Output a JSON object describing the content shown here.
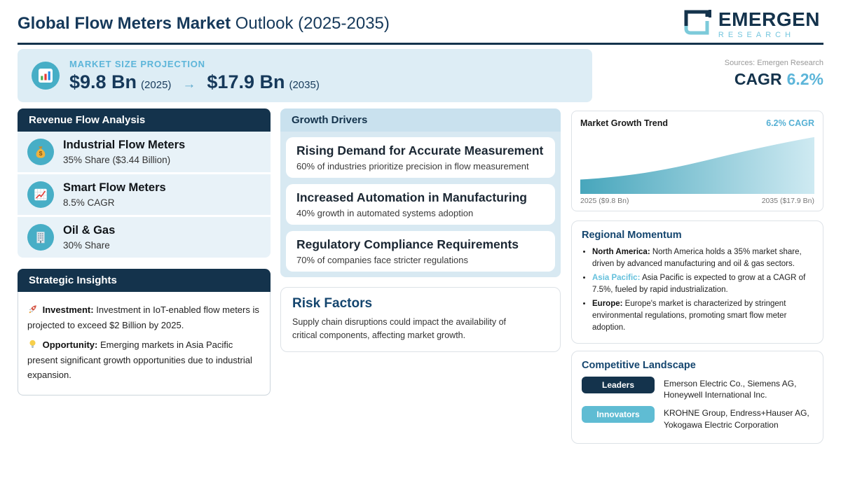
{
  "page": {
    "title_bold": "Global Flow Meters Market",
    "title_rest": " Outlook (2025-2035)"
  },
  "logo": {
    "name": "EMERGEN",
    "sub": "RESEARCH",
    "mark_icon": "emergen-square-logo-icon"
  },
  "banner": {
    "icon": "bar-chart-icon",
    "label": "MARKET SIZE PROJECTION",
    "start_value": "$9.8 Bn",
    "start_year": "(2025)",
    "arrow": "→",
    "end_value": "$17.9 Bn",
    "end_year": "(2035)",
    "sources": "Sources: Emergen Research",
    "cagr_label": "CAGR",
    "cagr_value": "6.2%"
  },
  "revenue": {
    "header": "Revenue Flow Analysis",
    "items": [
      {
        "icon": "money-bag-icon",
        "title": "Industrial Flow Meters",
        "subtitle": "35% Share ($3.44 Billion)"
      },
      {
        "icon": "line-chart-icon",
        "title": "Smart Flow Meters",
        "subtitle": "8.5% CAGR"
      },
      {
        "icon": "building-icon",
        "title": "Oil & Gas",
        "subtitle": "30% Share"
      }
    ]
  },
  "strategic": {
    "header": "Strategic Insights",
    "items": [
      {
        "icon": "rocket-icon",
        "label": "Investment:",
        "text": " Investment in IoT-enabled flow meters is projected to exceed $2 Billion by 2025."
      },
      {
        "icon": "bulb-icon",
        "label": "Opportunity:",
        "text": " Emerging markets in Asia Pacific present significant growth opportunities due to industrial expansion."
      }
    ]
  },
  "growth": {
    "header": "Growth Drivers",
    "items": [
      {
        "title": "Rising Demand for Accurate Measurement",
        "subtitle": "60% of industries prioritize precision in flow measurement"
      },
      {
        "title": "Increased Automation in Manufacturing",
        "subtitle": "40% growth in automated systems adoption"
      },
      {
        "title": "Regulatory Compliance Requirements",
        "subtitle": "70% of companies face stricter regulations"
      }
    ]
  },
  "risk": {
    "header": "Risk Factors",
    "text": "Supply chain disruptions could impact the availability of critical components, affecting market growth."
  },
  "trend": {
    "title": "Market Growth Trend",
    "cagr": "6.2% CAGR",
    "label_start": "2025 ($9.8 Bn)",
    "label_end": "2035 ($17.9 Bn)"
  },
  "chart_data": {
    "type": "area",
    "title": "Market Growth Trend",
    "x": [
      2025,
      2035
    ],
    "series": [
      {
        "name": "Market Size (USD Bn)",
        "values": [
          9.8,
          17.9
        ]
      }
    ],
    "annotations": [
      "6.2% CAGR"
    ],
    "xlabels": [
      "2025 ($9.8 Bn)",
      "2035 ($17.9 Bn)"
    ],
    "legend": "none",
    "grid": false,
    "fill_gradient": [
      "#47a6bc",
      "#cfeaf2"
    ]
  },
  "regional": {
    "header": "Regional Momentum",
    "items": [
      {
        "label": "North America:",
        "text": " North America holds a 35% market share, driven by advanced manufacturing and oil & gas sectors.",
        "accent": false
      },
      {
        "label": "Asia Pacific:",
        "text": " Asia Pacific is expected to grow at a CAGR of 7.5%, fueled by rapid industrialization.",
        "accent": true
      },
      {
        "label": "Europe:",
        "text": " Europe's market is characterized by stringent environmental regulations, promoting smart flow meter adoption.",
        "accent": false
      }
    ]
  },
  "competitive": {
    "header": "Competitive Landscape",
    "rows": [
      {
        "badge": "Leaders",
        "companies": "Emerson Electric Co., Siemens AG, Honeywell International Inc."
      },
      {
        "badge": "Innovators",
        "companies": "KROHNE Group, Endress+Hauser AG, Yokogawa Electric Corporation"
      }
    ]
  },
  "colors": {
    "navy": "#14334c",
    "title_blue": "#16395a",
    "accent_blue": "#5cb5d9",
    "teal_circle": "#47aec6",
    "banner_bg": "#ddedf5",
    "item_bg": "#e8f2f8",
    "growth_header_bg": "#c9e1ee",
    "growth_body_bg": "#d8e9f2",
    "innovators_badge": "#5fbcd3"
  }
}
